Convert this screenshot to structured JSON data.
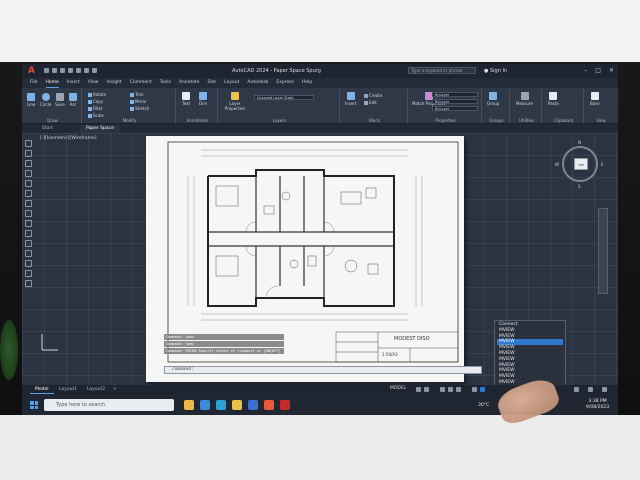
{
  "window": {
    "title": "AutoCAD 2024  -  Paper Space Spurg",
    "search_placeholder": "Type a keyword or phrase",
    "signin": "Sign In"
  },
  "menu": {
    "tabs": [
      "File",
      "Home",
      "Insert",
      "View",
      "Insight",
      "Comment",
      "Tools",
      "Annotate",
      "Site",
      "Layout",
      "Autodesk",
      "Express",
      "Help"
    ],
    "active_index": 1
  },
  "ribbon": {
    "draw": {
      "title": "Draw",
      "line": "Line",
      "circle": "Circle",
      "save": "Save",
      "arc": "Arc"
    },
    "modify": {
      "title": "Modify",
      "items": [
        "Rotate",
        "Trim",
        "Copy",
        "Mirror",
        "Fillet",
        "Stretch",
        "Scale",
        "Array"
      ]
    },
    "annotation": {
      "title": "Annotation",
      "text": "Text",
      "dimension": "Dim"
    },
    "layers": {
      "title": "Layers",
      "layer_props": "Layer Properties",
      "unsaved": "Unsaved Layer State"
    },
    "block": {
      "title": "Block",
      "insert": "Insert",
      "create": "Create",
      "edit": "Edit"
    },
    "properties": {
      "title": "Properties",
      "match": "Match Properties",
      "bylayer1": "ByLayer",
      "bylayer2": "ByLayer",
      "bylayer3": "ByLayer"
    },
    "groups": {
      "title": "Groups",
      "group": "Group"
    },
    "utilities": {
      "title": "Utilities",
      "measure": "Measure"
    },
    "clipboard": {
      "title": "Clipboard",
      "paste": "Paste"
    },
    "view": {
      "title": "View",
      "base": "Base"
    }
  },
  "filetabs": {
    "start": "Start",
    "current": "Paper Space"
  },
  "viewport_label": "[-][Isometric][Wireframe]",
  "titleblock": {
    "project": "MODEST DISO",
    "scale": "1:50/A3"
  },
  "command": {
    "history": [
      "Command: Spec",
      "Command: Spec",
      "Command: MVIEW Specify corner of viewport or [ON/OFF]"
    ],
    "prompt": "command:",
    "input": ""
  },
  "autocomplete": {
    "items": [
      "Connect",
      "MVIEW",
      "MVIEW",
      "MVIEW",
      "MVIEW",
      "MVIEW",
      "MVIEW",
      "MVIEW",
      "MVIEW",
      "MVIEW",
      "MVIEW"
    ],
    "selected_index": 3
  },
  "viewcube": {
    "face": "TOP",
    "n": "N",
    "s": "S",
    "e": "E",
    "w": "W"
  },
  "layout_tabs": [
    "Model",
    "Layout1",
    "Layout2"
  ],
  "layout_active": 0,
  "status": {
    "model": "MODEL"
  },
  "taskbar": {
    "search": "Type here to search",
    "temperature": "30°C",
    "time": "3:38 PM",
    "date": "9/08/2023"
  }
}
